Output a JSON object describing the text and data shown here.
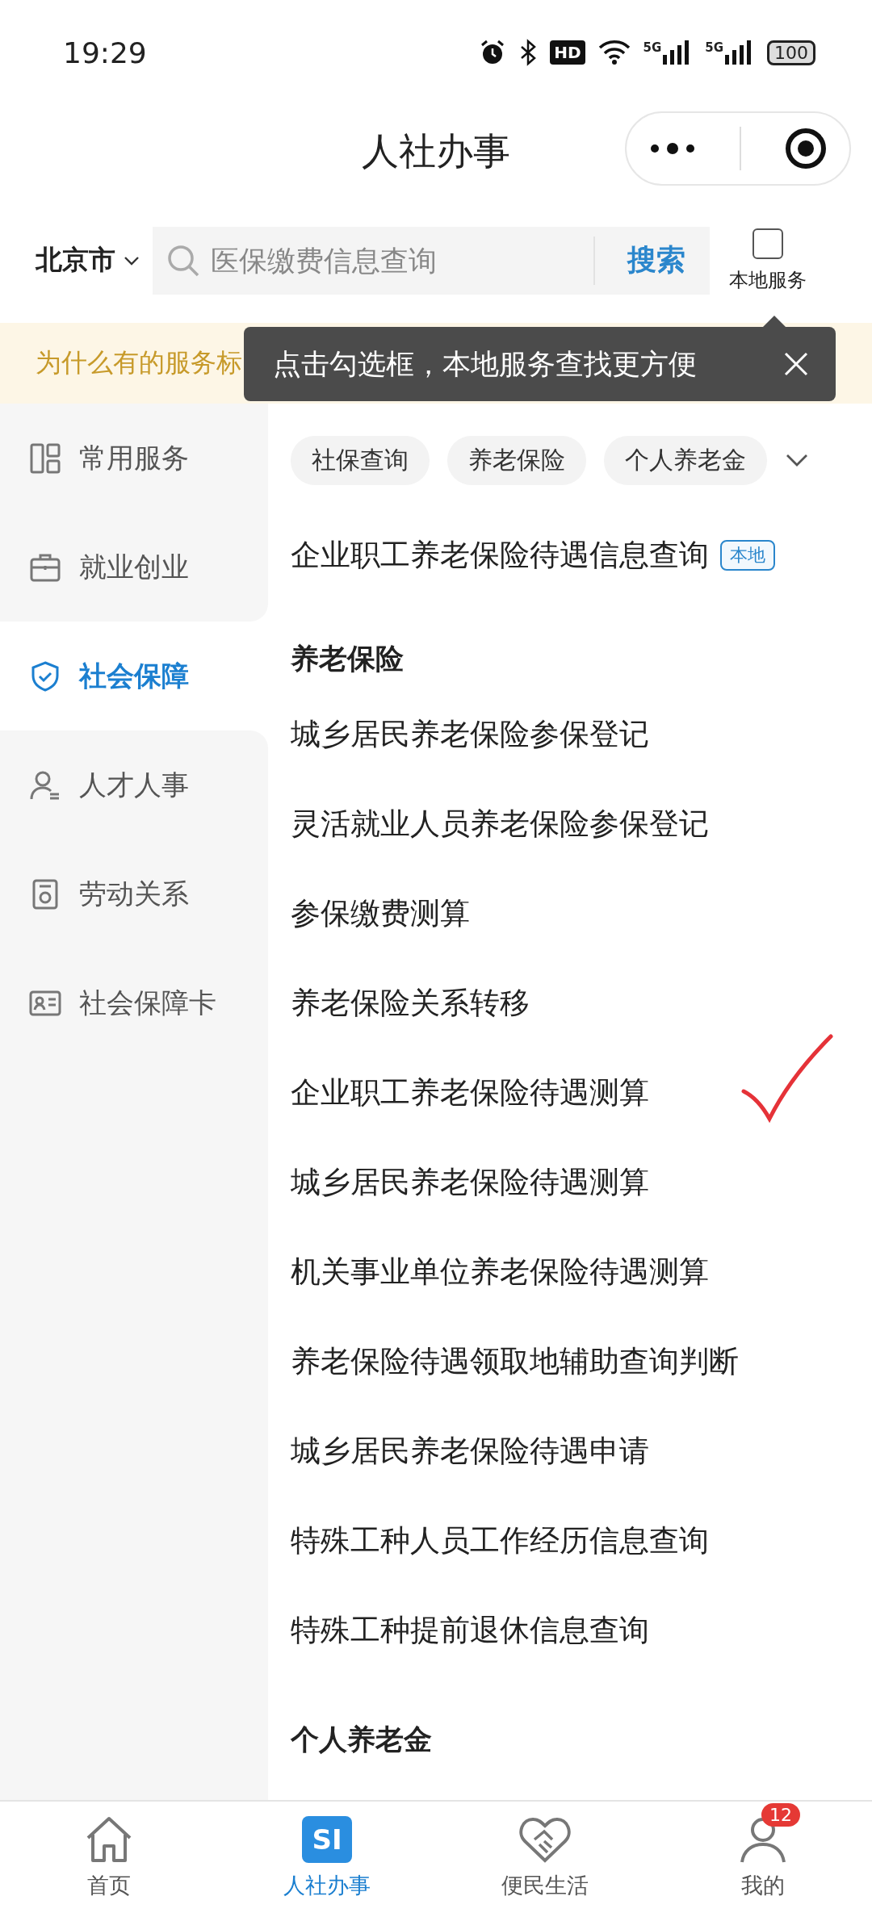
{
  "status_bar": {
    "time": "19:29",
    "hd": "HD",
    "networks": [
      "5G",
      "5G"
    ],
    "battery": "100"
  },
  "header": {
    "title": "人社办事"
  },
  "search": {
    "city": "北京市",
    "placeholder": "医保缴费信息查询",
    "button": "搜索",
    "local_filter": {
      "label": "本地服务",
      "checked": false
    }
  },
  "banner": {
    "text": "为什么有的服务标"
  },
  "tooltip": {
    "text": "点击勾选框，本地服务查找更方便"
  },
  "sidebar": {
    "items": [
      {
        "label": "常用服务",
        "selected": false
      },
      {
        "label": "就业创业",
        "selected": false
      },
      {
        "label": "社会保障",
        "selected": true
      },
      {
        "label": "人才人事",
        "selected": false
      },
      {
        "label": "劳动关系",
        "selected": false
      },
      {
        "label": "社会保障卡",
        "selected": false
      }
    ]
  },
  "chips": [
    "社保查询",
    "养老保险",
    "个人养老金"
  ],
  "featured": {
    "label": "企业职工养老保险待遇信息查询",
    "badge": "本地"
  },
  "sections": [
    {
      "title": "养老保险",
      "items": [
        "城乡居民养老保险参保登记",
        "灵活就业人员养老保险参保登记",
        "参保缴费测算",
        "养老保险关系转移",
        "企业职工养老保险待遇测算",
        "城乡居民养老保险待遇测算",
        "机关事业单位养老保险待遇测算",
        "养老保险待遇领取地辅助查询判断",
        "城乡居民养老保险待遇申请",
        "特殊工种人员工作经历信息查询",
        "特殊工种提前退休信息查询"
      ]
    },
    {
      "title": "个人养老金"
    }
  ],
  "tab_bar": [
    {
      "label": "首页",
      "selected": false
    },
    {
      "label": "人社办事",
      "selected": true,
      "icon_text": "SI"
    },
    {
      "label": "便民生活",
      "selected": false
    },
    {
      "label": "我的",
      "selected": false,
      "badge": "12"
    }
  ]
}
